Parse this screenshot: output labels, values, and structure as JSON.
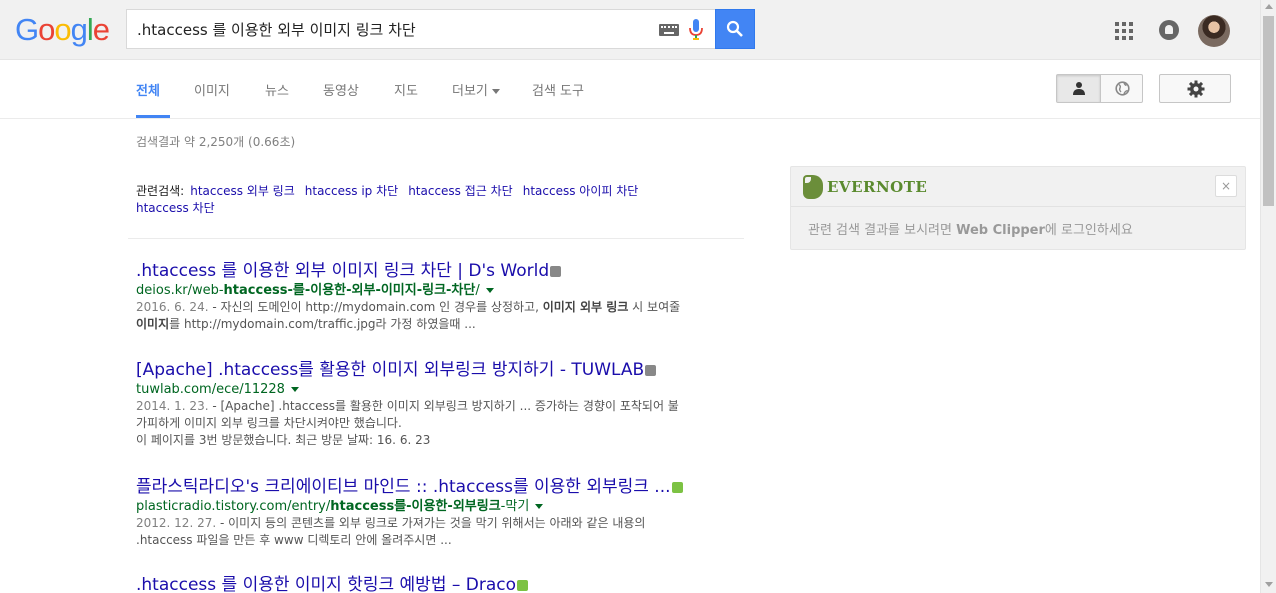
{
  "header": {
    "logo_letters": [
      "G",
      "o",
      "o",
      "g",
      "l",
      "e"
    ],
    "logo_colors": [
      "#4285f4",
      "#ea4335",
      "#fbbc05",
      "#4285f4",
      "#34a853",
      "#ea4335"
    ],
    "search_query": ".htaccess 를 이용한 외부 이미지 링크 차단",
    "icons": [
      "keyboard-icon",
      "mic-icon",
      "search-icon",
      "apps-icon",
      "notifications-icon",
      "avatar"
    ]
  },
  "tabs": [
    {
      "label": "전체",
      "active": true
    },
    {
      "label": "이미지",
      "active": false
    },
    {
      "label": "뉴스",
      "active": false
    },
    {
      "label": "동영상",
      "active": false
    },
    {
      "label": "지도",
      "active": false
    },
    {
      "label": "더보기",
      "active": false
    },
    {
      "label": "검색 도구",
      "active": false
    }
  ],
  "stats": "검색결과 약 2,250개 (0.66초)",
  "related": {
    "label": "관련검색:",
    "links": [
      "htaccess 외부 링크",
      "htaccess ip 차단",
      "htaccess 접근 차단",
      "htaccess 아이피 차단",
      "htaccess 차단"
    ]
  },
  "results": [
    {
      "title": ".htaccess 를 이용한 외부 이미지 링크 차단 | D's World",
      "url_plain": "deios.kr/web-",
      "url_bold": "htaccess-를-이용한-외부-이미지-링크-차단",
      "url_tail": "/",
      "date": "2016. 6. 24.",
      "snippet_1a": " - 자신의 도메인이 http://mydomain.com 인 경우를 상정하고, ",
      "snippet_1b": "이미지 외부 링크",
      "snippet_1c": " 시 보여줄",
      "snippet_2a": "이미지",
      "snippet_2b": "를 http://mydomain.com/traffic.jpg라 가정 하였을때 ...",
      "badge_color": "#888888"
    },
    {
      "title": "[Apache] .htaccess를 활용한 이미지 외부링크 방지하기 - TUWLAB",
      "url_plain": "tuwlab.com/ece/11228",
      "date": "2014. 1. 23.",
      "snippet_1": " - [Apache] .htaccess를 활용한 이미지 외부링크 방지하기 ... 증가하는 경향이 포착되어 불",
      "snippet_2": "가피하게 이미지 외부 링크를 차단시켜야만 했습니다.",
      "visited": "이 페이지를 3번 방문했습니다. 최근 방문 날짜: 16. 6. 23",
      "badge_color": "#888888"
    },
    {
      "title": "플라스틱라디오's 크리에이티브 마인드 :: .htaccess를 이용한 외부링크 ...",
      "url_plain": "plasticradio.tistory.com/entry/",
      "url_bold": "htaccess를-이용한-외부링크",
      "url_tail": "-막기",
      "date": "2012. 12. 27.",
      "snippet_1": " - 이미지 등의 콘텐츠를 외부 링크로 가져가는 것을 막기 위해서는 아래와 같은 내용의",
      "snippet_2": ".htaccess 파일을 만든 후 www 디렉토리 안에 올려주시면 ...",
      "badge_color": "#7cc243"
    },
    {
      "title": ".htaccess 를 이용한 이미지 핫링크 예방법 – Draco",
      "badge_color": "#7cc243"
    }
  ],
  "evernote": {
    "name": "EVERNOTE",
    "close": "×",
    "msg_a": "관련 검색 결과를 보시려면 ",
    "msg_b": "Web Clipper",
    "msg_c": "에 로그인하세요"
  }
}
